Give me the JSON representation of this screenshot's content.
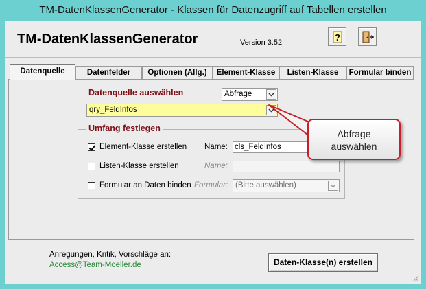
{
  "window": {
    "title": "TM-DatenKlassenGenerator - Klassen für Datenzugriff auf Tabellen erstellen",
    "frame_color": "#6bd0cf"
  },
  "header": {
    "app_title": "TM-DatenKlassenGenerator",
    "version": "Version 3.52",
    "help_icon": "question-mark-icon",
    "exit_icon": "exit-door-icon"
  },
  "tabs": [
    {
      "label": "Datenquelle",
      "active": true
    },
    {
      "label": "Datenfelder",
      "active": false
    },
    {
      "label": "Optionen (Allg.)",
      "active": false
    },
    {
      "label": "Element-Klasse",
      "active": false
    },
    {
      "label": "Listen-Klasse",
      "active": false
    },
    {
      "label": "Formular binden",
      "active": false
    }
  ],
  "datasource": {
    "heading": "Datenquelle auswählen",
    "type_value": "Abfrage",
    "source_value": "qry_FeldInfos",
    "highlight_color": "#fdfd9c",
    "heading_color": "#7f1018"
  },
  "scope": {
    "legend": "Umfang festlegen",
    "element_class": {
      "label": "Element-Klasse erstellen",
      "checked": true,
      "name_label": "Name:",
      "name_value": "cls_FeldInfos"
    },
    "list_class": {
      "label": "Listen-Klasse erstellen",
      "checked": false,
      "name_label": "Name:",
      "name_value": ""
    },
    "form_binding": {
      "label": "Formular an Daten binden",
      "checked": false,
      "form_label": "Formular:",
      "form_value": "(Bitte auswählen)"
    }
  },
  "callout": {
    "line1": "Abfrage",
    "line2": "auswählen",
    "border_color": "#c81e2a"
  },
  "footer": {
    "feedback_text": "Anregungen, Kritik, Vorschläge an:",
    "email": "Access@Team-Moeller.de",
    "create_button": "Daten-Klasse(n) erstellen"
  }
}
